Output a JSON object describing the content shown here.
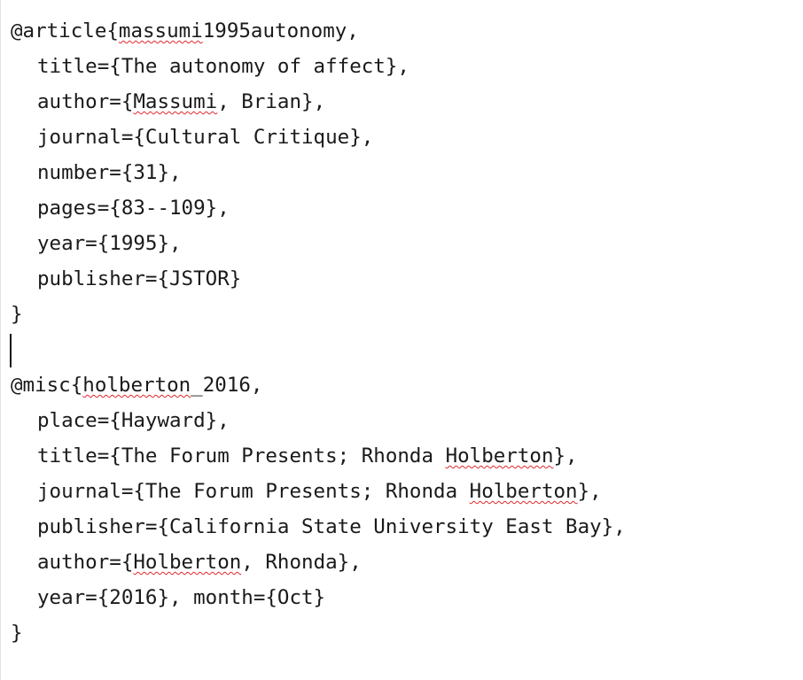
{
  "entries": [
    {
      "head": {
        "pre": "@article{",
        "word": "massumi",
        "post": "1995autonomy,"
      },
      "fields": [
        {
          "pre": "title={The autonomy of affect},"
        },
        {
          "pre": "author={",
          "word": "Massumi",
          "post": ", Brian},"
        },
        {
          "pre": "journal={Cultural Critique},"
        },
        {
          "pre": "number={31},"
        },
        {
          "pre": "pages={83--109},"
        },
        {
          "pre": "year={1995},"
        },
        {
          "pre": "publisher={JSTOR}"
        }
      ],
      "close": "}"
    },
    {
      "head": {
        "pre": "@misc{",
        "word": "holberton",
        "post": "_2016,"
      },
      "fields": [
        {
          "pre": "place={Hayward},"
        },
        {
          "pre": "title={The Forum Presents; Rhonda ",
          "word": "Holberton",
          "post": "},"
        },
        {
          "pre": "journal={The Forum Presents; Rhonda ",
          "word": "Holberton",
          "post": "},"
        },
        {
          "pre": "publisher={California State University East Bay},"
        },
        {
          "pre": "author={",
          "word": "Holberton",
          "post": ", Rhonda},"
        },
        {
          "pre": "year={2016}, month={Oct}"
        }
      ],
      "close": "}"
    }
  ],
  "theme": {
    "text_color": "#1a1a1a",
    "spellcheck_underline_color": "#e0282e",
    "background": "#ffffff"
  }
}
